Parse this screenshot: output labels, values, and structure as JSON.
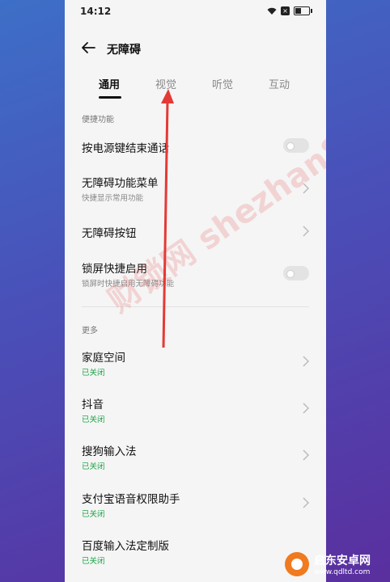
{
  "status_bar": {
    "time": "14:12",
    "sim_label": "×"
  },
  "header": {
    "title": "无障碍"
  },
  "tabs": [
    {
      "label": "通用"
    },
    {
      "label": "视觉"
    },
    {
      "label": "听觉"
    },
    {
      "label": "互动"
    }
  ],
  "sections": {
    "shortcut": {
      "title": "便捷功能"
    },
    "more": {
      "title": "更多"
    }
  },
  "shortcut_items": [
    {
      "label": "按电源键结束通话",
      "sub": ""
    },
    {
      "label": "无障碍功能菜单",
      "sub": "快捷显示常用功能"
    },
    {
      "label": "无障碍按钮",
      "sub": ""
    },
    {
      "label": "锁屏快捷启用",
      "sub": "锁屏时快捷启用无障碍功能"
    }
  ],
  "more_items": [
    {
      "label": "家庭空间",
      "status": "已关闭"
    },
    {
      "label": "抖音",
      "status": "已关闭"
    },
    {
      "label": "搜狗输入法",
      "status": "已关闭"
    },
    {
      "label": "支付宝语音权限助手",
      "status": "已关闭"
    },
    {
      "label": "百度输入法定制版",
      "status": "已关闭"
    }
  ],
  "watermark": "财锁网 shezhan88.com",
  "brand": {
    "name": "启东安卓网",
    "url": "www.qdltd.com"
  },
  "colors": {
    "accent_green": "#1fa64a",
    "arrow_red": "#e53935",
    "brand_orange": "#f07a1f"
  }
}
